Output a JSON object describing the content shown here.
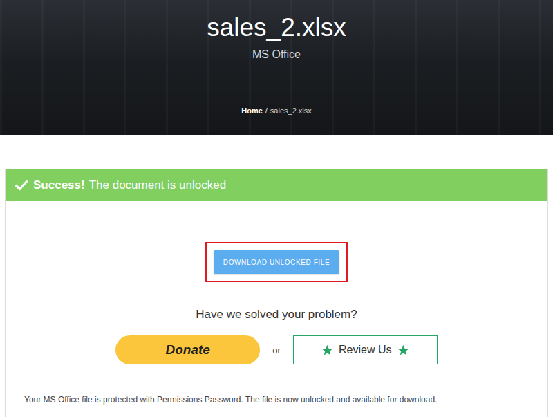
{
  "page": {
    "title": "sales_2.xlsx",
    "subtitle": "MS Office",
    "breadcrumb": [
      {
        "label": "Home",
        "current": false
      },
      {
        "label": "sales_2.xlsx",
        "current": true
      }
    ],
    "separator": "/"
  },
  "alert": {
    "strong": "Success!",
    "text": "The document is unlocked"
  },
  "download": {
    "label": "DOWNLOAD UNLOCKED FILE",
    "highlighted": true
  },
  "question": "Have we solved your problem?",
  "actions": {
    "donate": "Donate",
    "or": "or",
    "review": "Review Us"
  },
  "note": "Your MS Office file is protected with Permissions Password. The file is now unlocked and available for download."
}
